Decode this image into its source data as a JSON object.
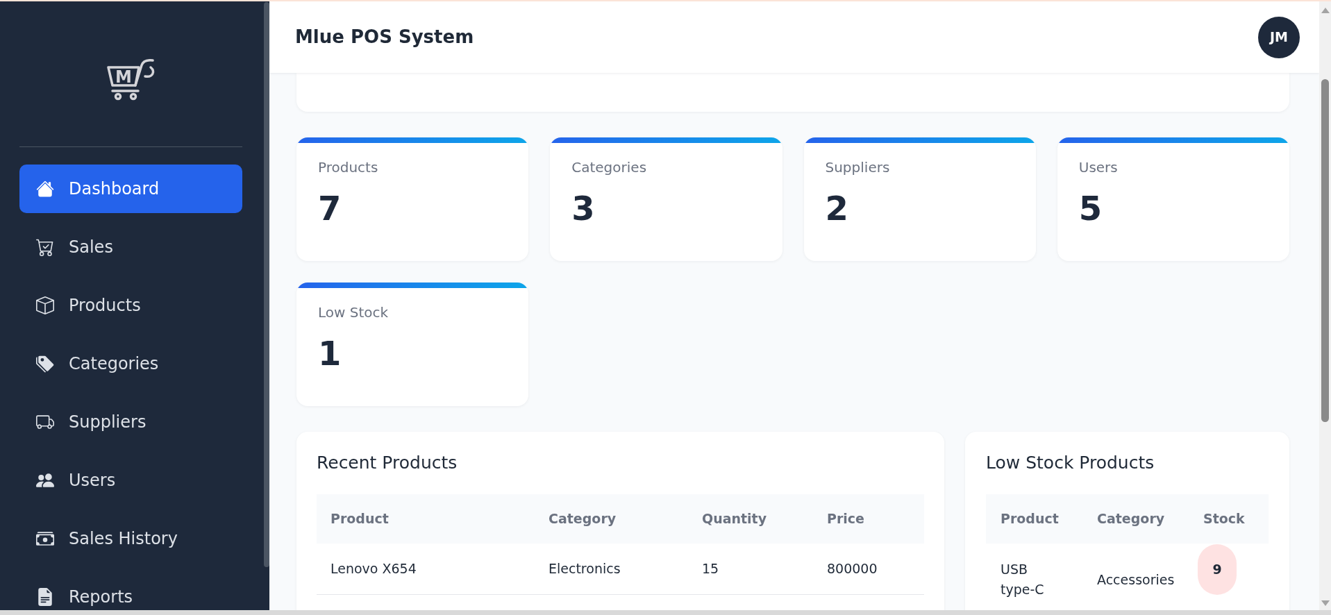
{
  "logo": {
    "letter": "M"
  },
  "sidebar": {
    "items": [
      {
        "label": "Dashboard",
        "selected": true
      },
      {
        "label": "Sales",
        "selected": false
      },
      {
        "label": "Products",
        "selected": false
      },
      {
        "label": "Categories",
        "selected": false
      },
      {
        "label": "Suppliers",
        "selected": false
      },
      {
        "label": "Users",
        "selected": false
      },
      {
        "label": "Sales History",
        "selected": false
      },
      {
        "label": "Reports",
        "selected": false
      }
    ]
  },
  "header": {
    "title": "Mlue POS System",
    "avatar_initials": "JM"
  },
  "stats": [
    {
      "label": "Products",
      "value": "7"
    },
    {
      "label": "Categories",
      "value": "3"
    },
    {
      "label": "Suppliers",
      "value": "2"
    },
    {
      "label": "Users",
      "value": "5"
    },
    {
      "label": "Low Stock",
      "value": "1"
    }
  ],
  "recent_products": {
    "title": "Recent Products",
    "columns": [
      "Product",
      "Category",
      "Quantity",
      "Price"
    ],
    "rows": [
      [
        "Lenovo X654",
        "Electronics",
        "15",
        "800000"
      ]
    ]
  },
  "low_stock_products": {
    "title": "Low Stock Products",
    "columns": [
      "Product",
      "Category",
      "Stock"
    ],
    "rows": [
      [
        "USB type-C",
        "Accessories",
        "9"
      ]
    ]
  }
}
